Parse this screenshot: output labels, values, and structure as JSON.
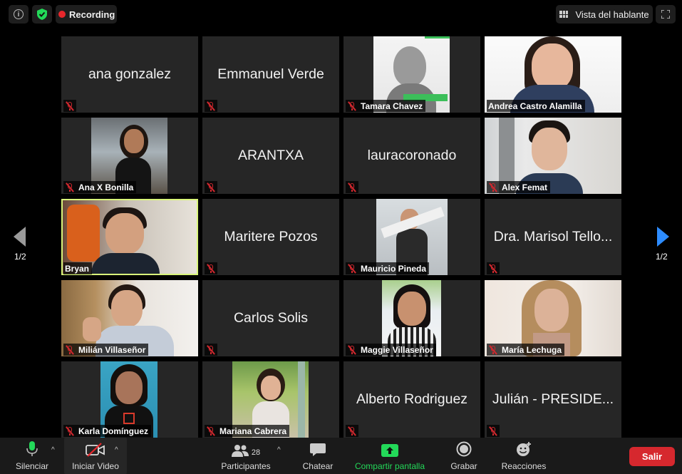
{
  "topbar": {
    "recording_label": "Recording",
    "speaker_view_label": "Vista del hablante"
  },
  "tiles": [
    {
      "name": "ana gonzalez",
      "type": "name"
    },
    {
      "name": "Emmanuel Verde",
      "type": "name"
    },
    {
      "name": "Tamara Chavez",
      "type": "video"
    },
    {
      "name": "Andrea Castro Alamilla",
      "type": "video"
    },
    {
      "name": "Ana X Bonilla",
      "type": "video"
    },
    {
      "name": "ARANTXA",
      "type": "name"
    },
    {
      "name": "lauracoronado",
      "type": "name"
    },
    {
      "name": "Alex Femat",
      "type": "video"
    },
    {
      "name": "Bryan",
      "type": "video",
      "active_speaker": true
    },
    {
      "name": "Maritere Pozos",
      "type": "name"
    },
    {
      "name": "Mauricio Pineda",
      "type": "video"
    },
    {
      "name": "Dra. Marisol Tello...",
      "type": "name"
    },
    {
      "name": "Milián Villaseñor",
      "type": "video"
    },
    {
      "name": "Carlos Solis",
      "type": "name"
    },
    {
      "name": "Maggie Villaseñor",
      "type": "video"
    },
    {
      "name": "María Lechuga",
      "type": "video"
    },
    {
      "name": "Karla Domínguez",
      "type": "video"
    },
    {
      "name": "Mariana Cabrera",
      "type": "video"
    },
    {
      "name": "Alberto Rodriguez",
      "type": "name"
    },
    {
      "name": "Julián - PRESIDE...",
      "type": "name"
    }
  ],
  "pager": {
    "left_page": "1/2",
    "right_page": "1/2"
  },
  "toolbar": {
    "mute_label": "Silenciar",
    "video_label": "Iniciar Video",
    "participants_label": "Participantes",
    "participants_count": "28",
    "chat_label": "Chatear",
    "share_label": "Compartir pantalla",
    "record_label": "Grabar",
    "reactions_label": "Reacciones",
    "leave_label": "Salir"
  },
  "colors": {
    "accent_blue": "#2d8cff",
    "share_green": "#23d959",
    "leave_red": "#d6282e",
    "record_red": "#e8272c",
    "active_speaker_border": "#d9f57a"
  }
}
